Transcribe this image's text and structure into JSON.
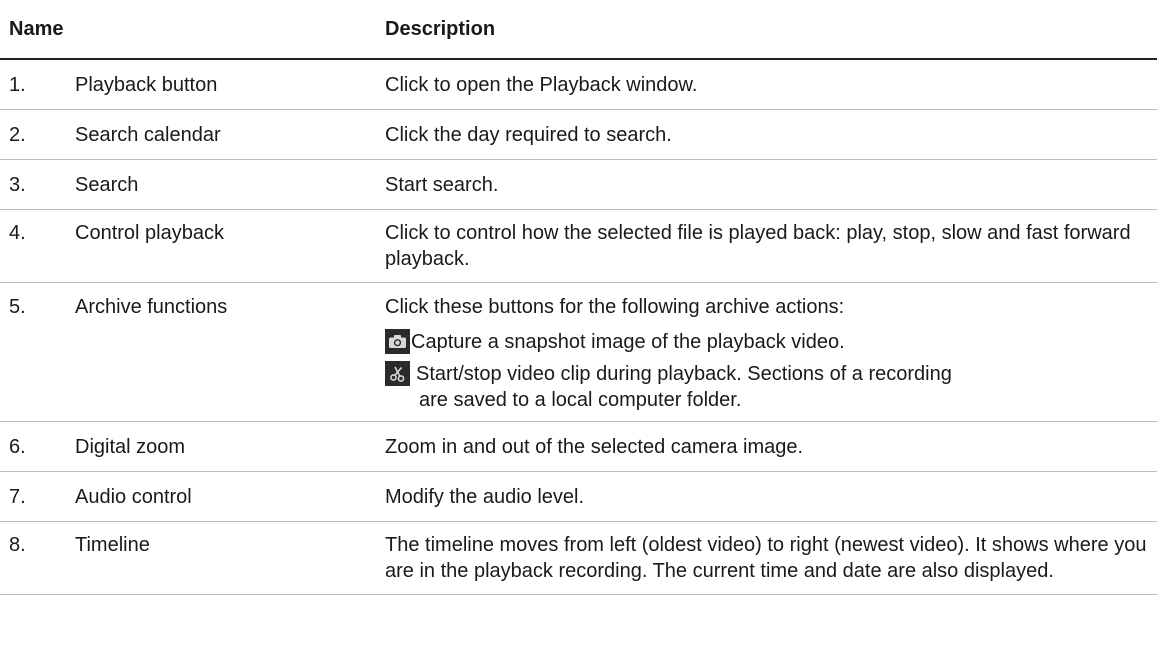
{
  "headers": {
    "name": "Name",
    "description": "Description"
  },
  "rows": [
    {
      "num": "1.",
      "name": "Playback button",
      "description": "Click to open the Playback window."
    },
    {
      "num": "2.",
      "name": "Search calendar",
      "description": "Click the day required to search."
    },
    {
      "num": "3.",
      "name": "Search",
      "description": "Start search."
    },
    {
      "num": "4.",
      "name": "Control playback",
      "description": "Click to control how the selected file is played back:  play, stop, slow and fast forward playback."
    },
    {
      "num": "5.",
      "name": "Archive functions",
      "description": "Click these buttons for the following archive actions:",
      "items": [
        {
          "icon": "camera-icon",
          "text": "Capture a snapshot image of the playback video."
        },
        {
          "icon": "scissors-icon",
          "text_line1": "Start/stop video clip during playback. Sections of a recording",
          "text_line2": "are saved to a local computer folder."
        }
      ]
    },
    {
      "num": "6.",
      "name": "Digital zoom",
      "description": "Zoom in and out of the selected camera image."
    },
    {
      "num": "7.",
      "name": "Audio control",
      "description": "Modify the audio level."
    },
    {
      "num": "8.",
      "name": "Timeline",
      "description": "The timeline moves from left (oldest video) to right (newest video). It shows where you are in the playback recording. The current time and date are also displayed."
    }
  ],
  "colors": {
    "icon_background": "#2b2b2b",
    "header_rule": "#222222",
    "row_rule": "#bdbdbd"
  }
}
